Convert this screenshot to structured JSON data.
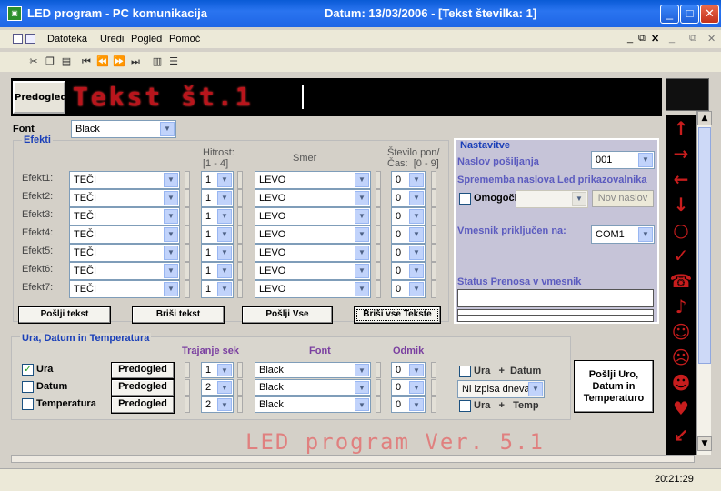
{
  "window": {
    "title": "LED program - PC komunikacija",
    "date": "Datum: 13/03/2006 - [Tekst številka:  1]"
  },
  "menu": [
    "Datoteka",
    "Uredi",
    "Pogled",
    "Pomoč"
  ],
  "preview": {
    "button": "Predogled",
    "led_text": "Tekst št.1"
  },
  "font": {
    "label": "Font",
    "value": "Black"
  },
  "efekti": {
    "title": "Efekti",
    "hitrost_header": "Hitrost:\n[1 - 4]",
    "smer_header": "Smer",
    "stevilo_header": "Število pon/\nČas:  [0 - 9]",
    "rows": [
      {
        "label": "Efekt1:",
        "effect": "TEČI",
        "speed": "1",
        "dir": "LEVO",
        "count": "0"
      },
      {
        "label": "Efekt2:",
        "effect": "TEČI",
        "speed": "1",
        "dir": "LEVO",
        "count": "0"
      },
      {
        "label": "Efekt3:",
        "effect": "TEČI",
        "speed": "1",
        "dir": "LEVO",
        "count": "0"
      },
      {
        "label": "Efekt4:",
        "effect": "TEČI",
        "speed": "1",
        "dir": "LEVO",
        "count": "0"
      },
      {
        "label": "Efekt5:",
        "effect": "TEČI",
        "speed": "1",
        "dir": "LEVO",
        "count": "0"
      },
      {
        "label": "Efekt6:",
        "effect": "TEČI",
        "speed": "1",
        "dir": "LEVO",
        "count": "0"
      },
      {
        "label": "Efekt7:",
        "effect": "TEČI",
        "speed": "1",
        "dir": "LEVO",
        "count": "0"
      }
    ],
    "buttons": [
      "Pošlji tekst",
      "Briši tekst",
      "Pošlji Vse",
      "Briši vse Tekste"
    ]
  },
  "nastavitve": {
    "title": "Nastavitve",
    "naslov_label": "Naslov pošiljanja",
    "naslov_value": "001",
    "sprememba_label": "Sprememba naslova Led prikazovalnika",
    "omogoci_label": "Omogoči",
    "nov_naslov": "Nov naslov",
    "vmesnik_label": "Vmesnik priključen na:",
    "vmesnik_value": "COM1",
    "status_label": "Status Prenosa v vmesnik"
  },
  "ura": {
    "title": "Ura, Datum in Temperatura",
    "trajanje_header": "Trajanje sek",
    "font_header": "Font",
    "odmik_header": "Odmik",
    "rows": [
      {
        "label": "Ura",
        "checked": true,
        "preview": "Predogled",
        "duration": "1",
        "font": "Black",
        "offset": "0"
      },
      {
        "label": "Datum",
        "checked": false,
        "preview": "Predogled",
        "duration": "2",
        "font": "Black",
        "offset": "0"
      },
      {
        "label": "Temperatura",
        "checked": false,
        "preview": "Predogled",
        "duration": "2",
        "font": "Black",
        "offset": "0"
      }
    ],
    "ura_datum": "Ura   +  Datum",
    "ni_izpisa": "Ni izpisa dneva",
    "ura_temp": "Ura   +   Temp",
    "send_button": "Pošlji Uro, Datum in Temperaturo"
  },
  "version": "LED program Ver. 5.1",
  "status": {
    "time": "20:21:29"
  }
}
